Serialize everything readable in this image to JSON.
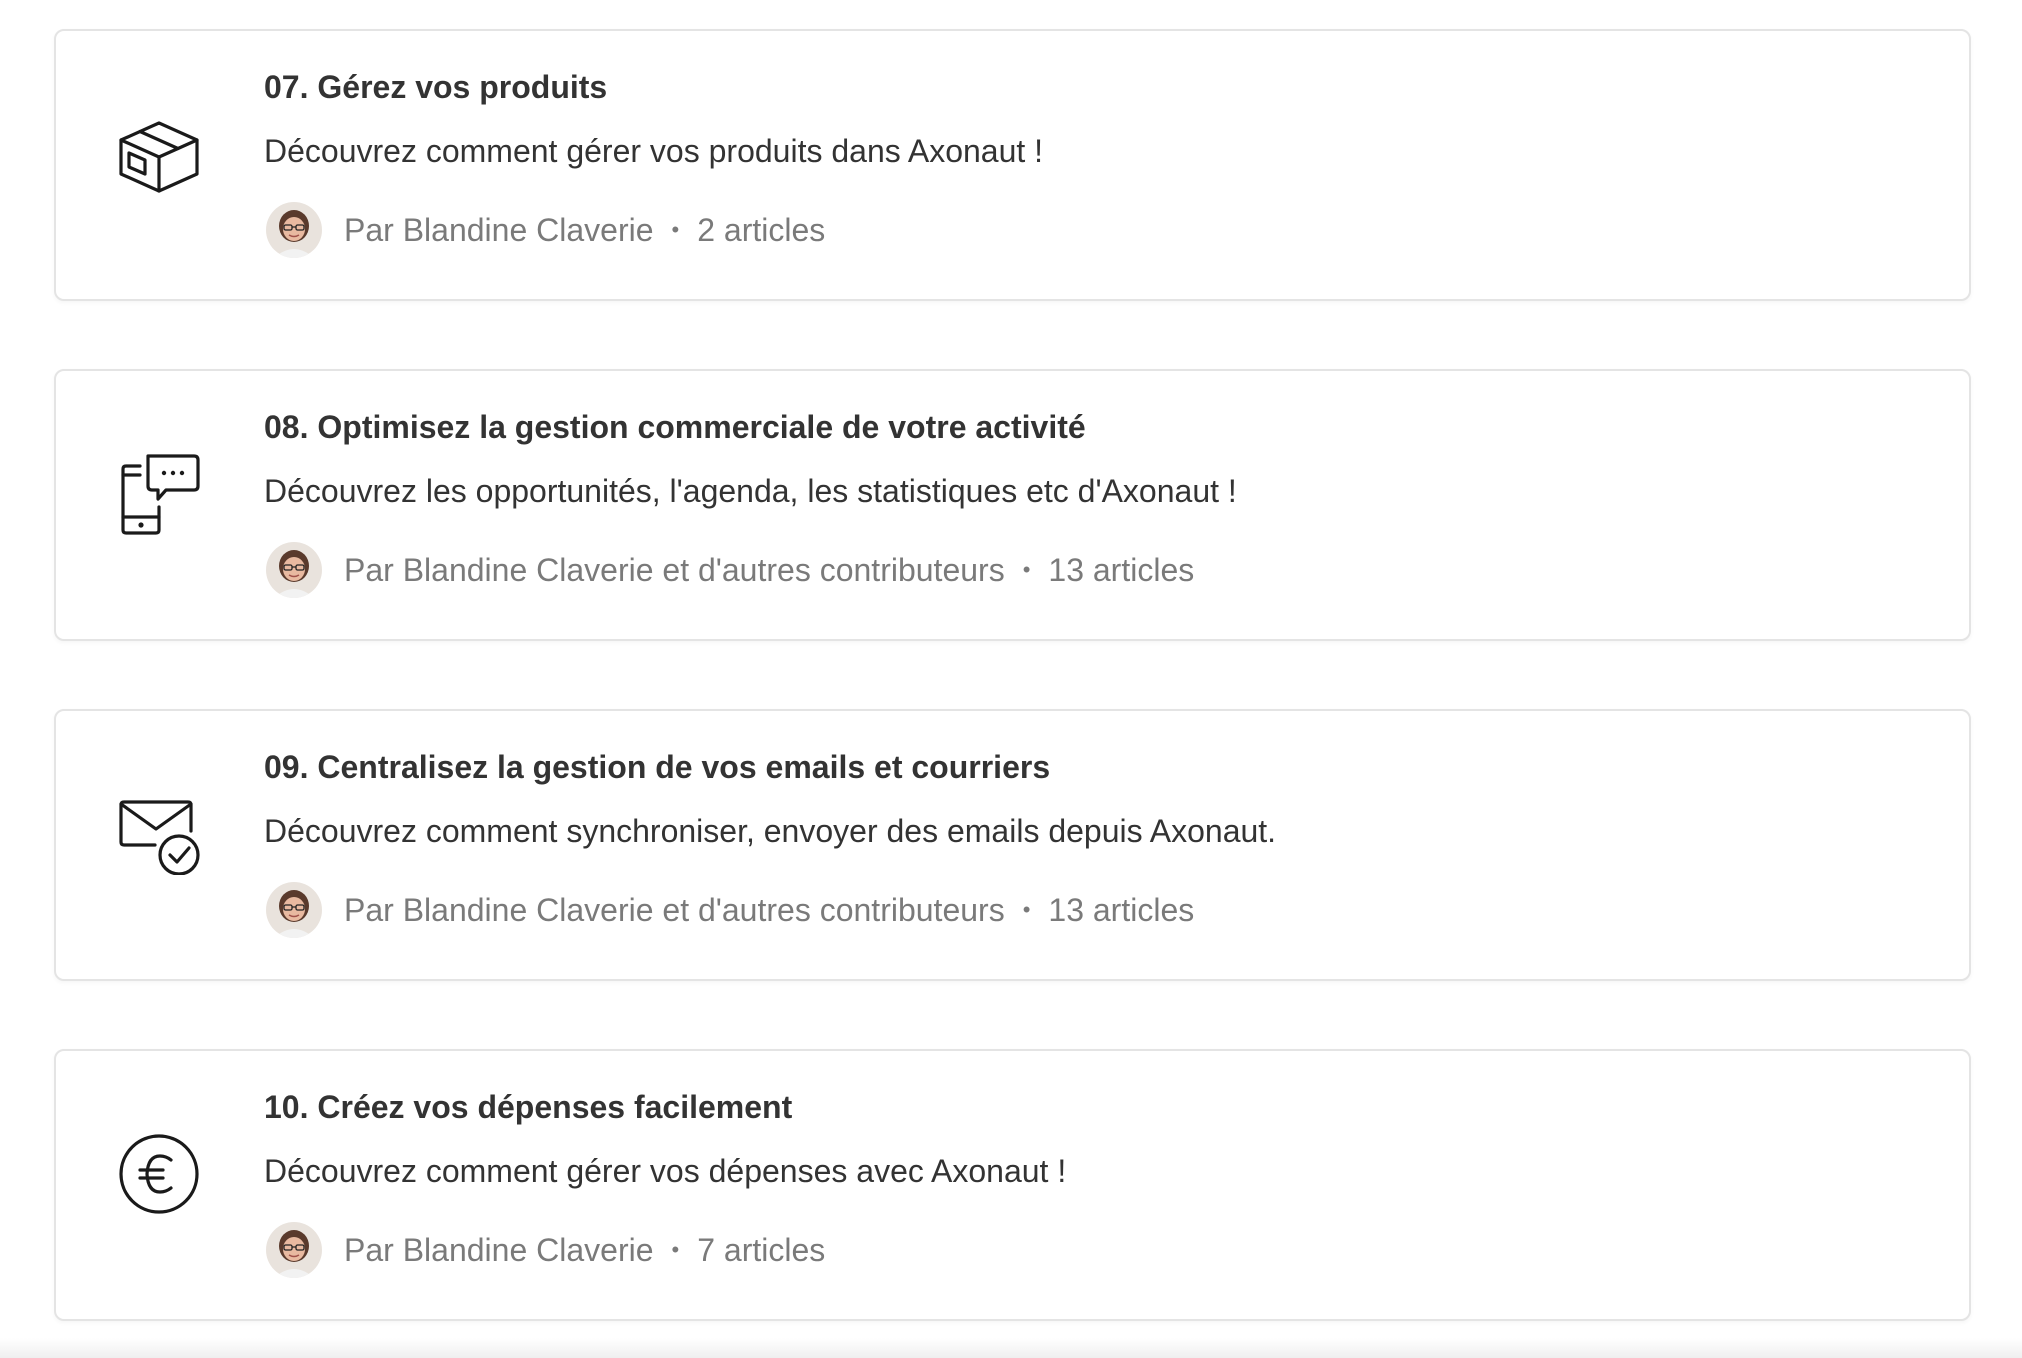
{
  "collections": [
    {
      "title": "07. Gérez vos produits",
      "description": "Découvrez comment gérer vos produits dans Axonaut !",
      "author": "Par Blandine Claverie",
      "count": "2 articles",
      "icon": "box-icon"
    },
    {
      "title": "08. Optimisez la gestion commerciale de votre activité",
      "description": "Découvrez les opportunités, l'agenda, les statistiques etc d'Axonaut !",
      "author": "Par Blandine Claverie et d'autres contributeurs",
      "count": "13 articles",
      "icon": "phone-chat-icon"
    },
    {
      "title": "09. Centralisez la gestion de vos emails et courriers",
      "description": "Découvrez comment synchroniser, envoyer des emails depuis Axonaut.",
      "author": "Par Blandine Claverie et d'autres contributeurs",
      "count": "13 articles",
      "icon": "mail-check-icon"
    },
    {
      "title": "10. Créez vos dépenses facilement",
      "description": "Découvrez comment gérer vos dépenses avec Axonaut !",
      "author": "Par Blandine Claverie",
      "count": "7 articles",
      "icon": "euro-icon"
    }
  ],
  "separator": "•",
  "colors": {
    "text": "#333333",
    "meta": "#7a7a7a",
    "border": "#e4e4e4"
  }
}
